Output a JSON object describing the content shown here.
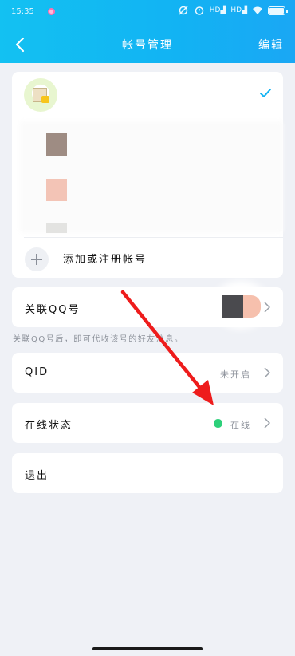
{
  "status_bar": {
    "time": "15:35",
    "network_labels": [
      "HD",
      "HD"
    ]
  },
  "header": {
    "title": "帐号管理",
    "edit_label": "编辑"
  },
  "accounts": {
    "add_label": "添加或注册帐号",
    "swatch_colors": [
      "#9e8c83",
      "#f3c4b6",
      "#e3e3e1"
    ]
  },
  "link_qq": {
    "label": "关联QQ号",
    "note": "关联QQ号后，即可代收该号的好友消息。"
  },
  "qid": {
    "label": "QID",
    "value": "未开启"
  },
  "online_status": {
    "label": "在线状态",
    "value": "在线",
    "dot_color": "#2dd07a"
  },
  "logout": {
    "label": "退出"
  },
  "colors": {
    "header": "#13b9f3",
    "arrow": "#ee1c1c",
    "background": "#eff1f6"
  }
}
